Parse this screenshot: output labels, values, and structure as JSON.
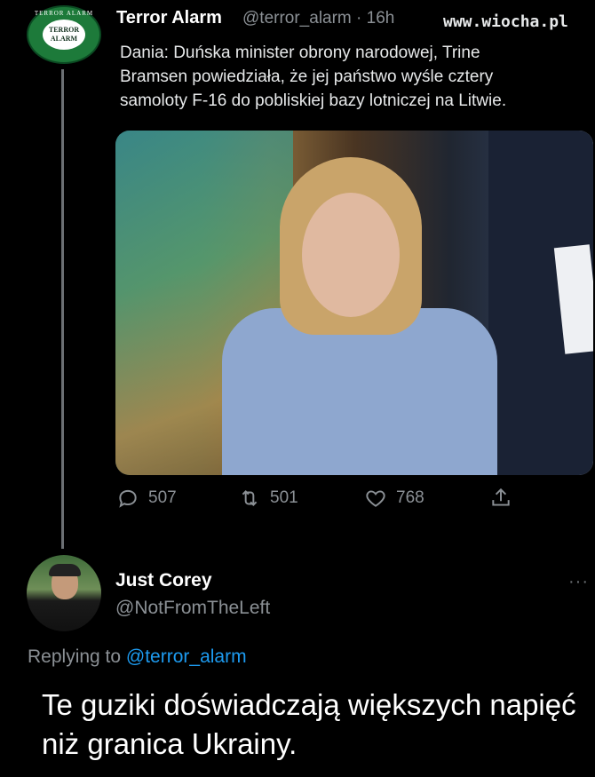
{
  "tweet": {
    "author_name": "Terror Alarm",
    "author_handle": "@terror_alarm · 16h",
    "avatar_text": "TERROR ALARM",
    "text": "Dania: Duńska minister obrony narodowej, Trine\nBramsen powiedziała, że jej państwo wyśle cztery\nsamoloty F-16 do pobliskiej bazy lotniczej na Litwie.",
    "replies": "507",
    "retweets": "501",
    "likes": "768"
  },
  "watermark": "www.wiocha.pl",
  "reply": {
    "author_name": "Just Corey",
    "author_handle": "@NotFromTheLeft",
    "replying_prefix": "Replying to ",
    "replying_mention": "@terror_alarm",
    "text": "Te guziki doświadczają większych napięć niż granica Ukrainy."
  },
  "icons": [
    "reply-icon",
    "retweet-icon",
    "like-icon",
    "share-icon",
    "more-icon"
  ],
  "colors": {
    "background": "#000000",
    "link": "#1d9bf0",
    "muted": "#8b9095"
  }
}
